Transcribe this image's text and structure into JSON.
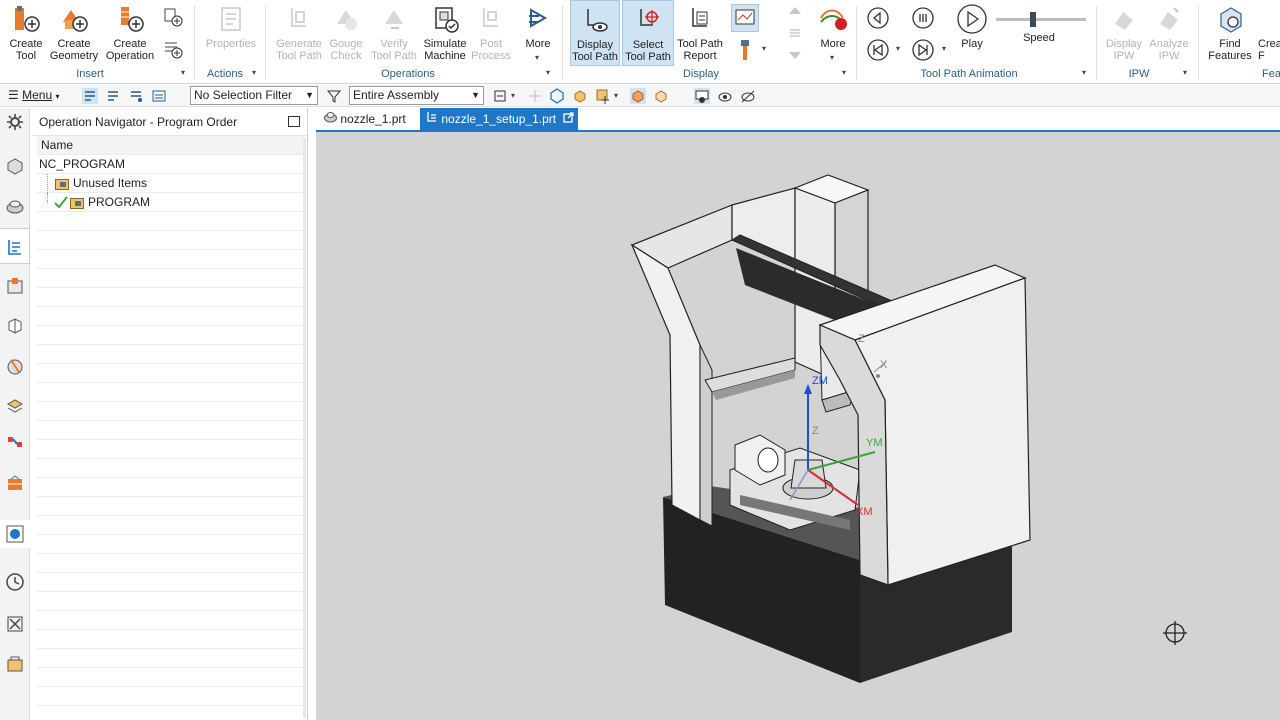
{
  "ribbon": {
    "insert": {
      "group": "Insert",
      "create_tool": "Create\nTool",
      "create_geometry": "Create\nGeometry",
      "create_operation": "Create\nOperation"
    },
    "actions": {
      "group": "Actions",
      "properties": "Properties"
    },
    "operations": {
      "group": "Operations",
      "generate_tool_path": "Generate\nTool Path",
      "gouge_check": "Gouge\nCheck",
      "verify_tool_path": "Verify\nTool Path",
      "simulate_machine": "Simulate\nMachine",
      "post_process": "Post\nProcess",
      "more": "More"
    },
    "display": {
      "group": "Display",
      "display_tool_path": "Display\nTool Path",
      "select_tool_path": "Select\nTool Path",
      "tool_path_report": "Tool Path\nReport",
      "more": "More"
    },
    "animation": {
      "group": "Tool Path Animation",
      "play": "Play",
      "speed": "Speed",
      "speed_level": 0.4
    },
    "ipw": {
      "group": "IPW",
      "display_ipw": "Display\nIPW",
      "analyze_ipw": "Analyze\nIPW"
    },
    "features": {
      "group": "Fea",
      "find_features": "Find\nFeatures",
      "create_partial": "Crea\nF"
    }
  },
  "toolbar2": {
    "menu": "Menu",
    "selection_filter": "No Selection Filter",
    "scope": "Entire Assembly"
  },
  "navigator": {
    "title": "Operation Navigator - Program Order",
    "column_name": "Name",
    "rows": [
      {
        "label": "NC_PROGRAM"
      },
      {
        "label": "Unused Items"
      },
      {
        "label": "PROGRAM"
      }
    ]
  },
  "tabs": [
    {
      "label": "nozzle_1.prt"
    },
    {
      "label": "nozzle_1_setup_1.prt"
    }
  ],
  "viewport": {
    "axes": {
      "zm": "ZM",
      "ym": "YM",
      "xm": "XM",
      "z": "Z",
      "x": "X",
      "z2": "Z"
    }
  },
  "colors": {
    "accent": "#1f77c7",
    "selected": "#cfe3f3",
    "group_label": "#2d5d8a"
  }
}
